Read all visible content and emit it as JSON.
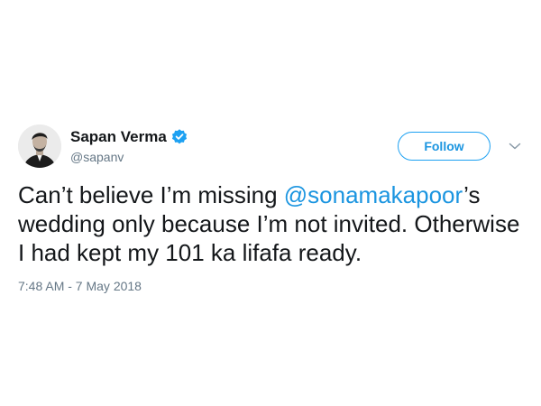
{
  "user": {
    "display_name": "Sapan Verma",
    "handle": "@sapanv",
    "verified": true
  },
  "follow_button": {
    "label": "Follow"
  },
  "tweet": {
    "text_part1": "Can’t believe I’m missing ",
    "mention": "@sonamakapoor",
    "text_part2": "’s wedding only because I’m not invited. Otherwise I had kept my 101 ka lifafa ready.",
    "timestamp": "7:48 AM - 7 May 2018"
  },
  "colors": {
    "accent": "#1da1f2",
    "link": "#1b95e0",
    "secondary_text": "#657786",
    "primary_text": "#14171a"
  },
  "icons": {
    "verified": "verified-badge-icon",
    "caret": "chevron-down-icon"
  }
}
